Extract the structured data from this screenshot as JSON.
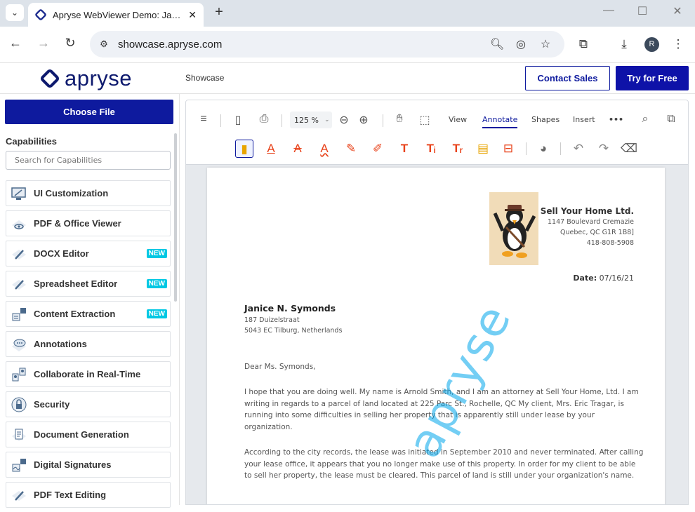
{
  "browser": {
    "tab_title": "Apryse WebViewer Demo: JavaScript PDF Viewer",
    "url": "showcase.apryse.com",
    "avatar_letter": "R"
  },
  "header": {
    "logo_text": "apryse",
    "breadcrumb": "Showcase",
    "contact_label": "Contact Sales",
    "try_label": "Try for Free"
  },
  "sidebar": {
    "choose_file": "Choose File",
    "capabilities_title": "Capabilities",
    "search_placeholder": "Search for Capabilities",
    "new_badge": "NEW",
    "items": [
      {
        "label": "UI Customization",
        "icon": "monitor-icon"
      },
      {
        "label": "PDF & Office Viewer",
        "icon": "eye-icon"
      },
      {
        "label": "DOCX Editor",
        "icon": "pencil-icon",
        "badge": "NEW"
      },
      {
        "label": "Spreadsheet Editor",
        "icon": "pencil-icon",
        "badge": "NEW"
      },
      {
        "label": "Content Extraction",
        "icon": "extract-icon",
        "badge": "NEW"
      },
      {
        "label": "Annotations",
        "icon": "comment-icon"
      },
      {
        "label": "Collaborate in Real-Time",
        "icon": "collaborate-icon"
      },
      {
        "label": "Security",
        "icon": "lock-icon"
      },
      {
        "label": "Document Generation",
        "icon": "document-icon"
      },
      {
        "label": "Digital Signatures",
        "icon": "signature-icon"
      },
      {
        "label": "PDF Text Editing",
        "icon": "pencil-icon"
      }
    ]
  },
  "viewer": {
    "zoom": "125 %",
    "tabs": [
      "View",
      "Annotate",
      "Shapes",
      "Insert"
    ],
    "active_tab": "Annotate",
    "more": "•••",
    "accent": "#0e1a9e",
    "tool_color": "#e8421a"
  },
  "document": {
    "company": {
      "name": "Sell Your Home Ltd.",
      "address1": "1147 Boulevard Cremazie",
      "address2": "Quebec, QC G1R 1B8]",
      "phone": "418-808-5908"
    },
    "date_label": "Date:",
    "date_value": "07/16/21",
    "recipient": {
      "name": "Janice N. Symonds",
      "address1": "187 Duizelstraat",
      "address2": "5043 EC Tilburg, Netherlands"
    },
    "salutation": "Dear Ms. Symonds,",
    "para1": "I hope that you are doing well. My name is Arnold Smith, and I am an attorney at Sell Your Home, Ltd. I am writing in regards to a parcel of land located at 225 Parc St., Rochelle, QC  My client, Mrs. Eric Tragar, is running into some difficulties in selling her property that is apparently still under lease by your organization.",
    "para2": "According to the city records, the lease was initiated in September 2010 and never terminated. After calling your lease office, it appears that you no longer make use of this property. In order for my client to be able to sell her property, the lease must be cleared. This parcel of land is still under your organization's name.",
    "watermark": "apryse"
  }
}
